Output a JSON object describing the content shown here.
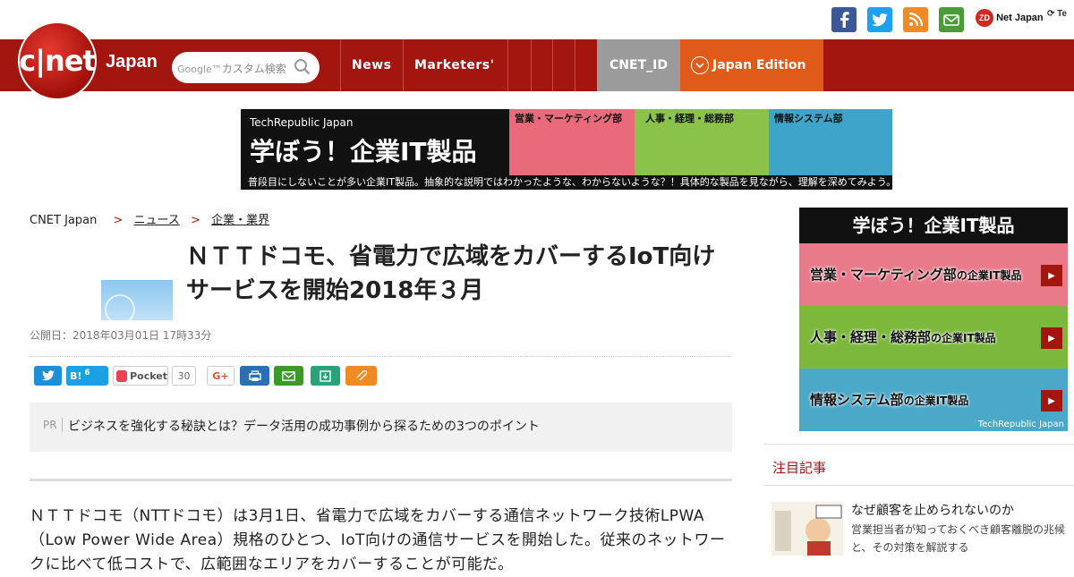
{
  "social": {
    "icons": [
      "facebook-icon",
      "twitter-icon",
      "rss-icon",
      "mail-icon"
    ],
    "colors": {
      "facebook": "#3b5998",
      "twitter": "#1da1f2",
      "rss": "#f08a24",
      "mail": "#4a9b3a"
    },
    "zdnet_label": "Net Japan",
    "zdnet_badge": "ZD",
    "techrepublic_label": "Te"
  },
  "header": {
    "logo_text": "c|net",
    "japan_label": "Japan",
    "search_placeholder_brand": "Google™",
    "search_placeholder": "カスタム検索",
    "nav": [
      "News",
      "Marketers'"
    ],
    "cnet_id": "CNET_ID",
    "edition": "Japan Edition",
    "accent": "#a3160f"
  },
  "banner": {
    "brand": "TechRepublic Japan",
    "headline": "学ぼう！企業IT製品",
    "panels": [
      "営業・マーケティング部",
      "人事・経理・総務部",
      "情報システム部"
    ],
    "caption": "普段目にしないことが多い企業IT製品。抽象的な説明ではわかったような、わからないような？！具体的な製品を見ながら、理解を深めてみよう。"
  },
  "breadcrumb": {
    "root": "CNET Japan",
    "items": [
      "ニュース",
      "企業・業界"
    ]
  },
  "article": {
    "title": "ＮＴＴドコモ、省電力で広域をカバーするIoT向けサービスを開始2018年３月",
    "date": "公開日：2018年03月01日 17時33分",
    "share": {
      "hatena_label": "B!",
      "hatena_count": "6",
      "pocket_label": "Pocket",
      "pocket_count": "30",
      "gplus_label": "G+"
    },
    "pr_tag": "PR",
    "pr_text": "ビジネスを強化する秘訣とは？データ活用の成功事例から探るための3つのポイント",
    "body": "ＮＴＴドコモ（NTTドコモ）は3月1日、省電力で広域をカバーする通信ネットワーク技術LPWA（Low Power Wide Area）規格のひとつ、IoT向けの通信サービスを開始した。従来のネットワークに比べて低コストで、広範囲なエリアをカバーすることが可能だ。"
  },
  "sidebar": {
    "ad_header": "学ぼう！企業IT製品",
    "rows": [
      {
        "label": "営業・マーケティング部",
        "suffix": "の企業IT製品",
        "color": "#e87a8a"
      },
      {
        "label": "人事・経理・総務部",
        "suffix": "の企業IT製品",
        "color": "#7bb83c"
      },
      {
        "label": "情報システム部",
        "suffix": "の企業IT製品",
        "color": "#4aa8c8"
      }
    ],
    "ad_brand": "TechRepublic Japan",
    "section_title": "注目記事",
    "pick_title": "なぜ顧客を止められないのか",
    "pick_desc": "営業担当者が知っておくべき顧客離脱の兆候と、その対策を解説する"
  }
}
